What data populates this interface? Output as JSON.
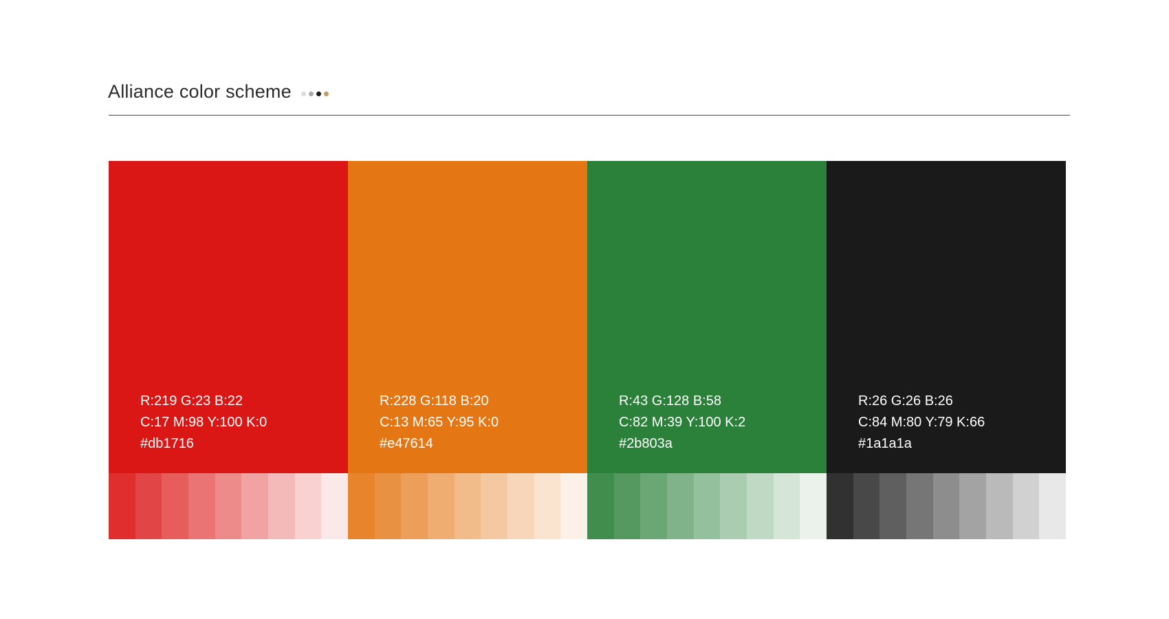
{
  "header": {
    "title": "Alliance color scheme",
    "dots": [
      "#dcdcdc",
      "#a9a9a9",
      "#1a1a1a",
      "#c49a64"
    ]
  },
  "swatches": [
    {
      "name": "red",
      "color": "#db1716",
      "rgb": "R:219 G:23 B:22",
      "cmyk": "C:17 M:98 Y:100 K:0",
      "hex": "#db1716",
      "tints": [
        "#df2e2d",
        "#e24545",
        "#e65d5c",
        "#e97473",
        "#ed8b8b",
        "#f1a2a2",
        "#f4b9b9",
        "#f8d1d0",
        "#fbe8e8"
      ]
    },
    {
      "name": "orange",
      "color": "#e47614",
      "rgb": "R:228 G:118 B:20",
      "cmyk": "C:13 M:65 Y:95 K:0",
      "hex": "#e47614",
      "tints": [
        "#e7842c",
        "#e99143",
        "#ec9f5b",
        "#efad72",
        "#f2bb8a",
        "#f4c8a1",
        "#f7d6b9",
        "#fae4d0",
        "#fcf1e8"
      ]
    },
    {
      "name": "green",
      "color": "#2b803a",
      "rgb": "R:43 G:128 B:58",
      "cmyk": "C:82 M:39 Y:100 K:2",
      "hex": "#2b803a",
      "tints": [
        "#408d4e",
        "#559961",
        "#6ba675",
        "#80b389",
        "#95c09d",
        "#aaccb0",
        "#bfd9c4",
        "#d5e6d8",
        "#eaf2eb"
      ]
    },
    {
      "name": "black",
      "color": "#1a1a1a",
      "rgb": "R:26 G:26 B:26",
      "cmyk": "C:84 M:80 Y:79 K:66",
      "hex": "#1a1a1a",
      "tints": [
        "#313131",
        "#484848",
        "#5f5f5f",
        "#767676",
        "#8d8d8d",
        "#a3a3a3",
        "#bababa",
        "#d1d1d1",
        "#e8e8e8"
      ]
    }
  ]
}
